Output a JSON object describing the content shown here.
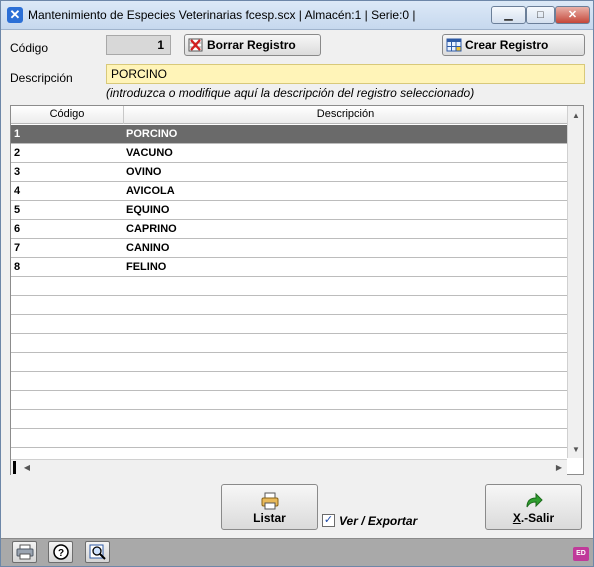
{
  "window": {
    "title": "Mantenimiento de Especies Veterinarias fcesp.scx   | Almacén:1 | Serie:0 |",
    "icon": "app-x-icon"
  },
  "form": {
    "codigo_label": "Código",
    "codigo_value": "1",
    "borrar_label": "Borrar Registro",
    "crear_label": "Crear Registro",
    "descripcion_label": "Descripción",
    "descripcion_value": "PORCINO",
    "hint": "(introduzca o modifique aquí la descripción del registro seleccionado)"
  },
  "grid": {
    "columns": [
      "Código",
      "Descripción"
    ],
    "rows": [
      {
        "codigo": "1",
        "descripcion": "PORCINO"
      },
      {
        "codigo": "2",
        "descripcion": "VACUNO"
      },
      {
        "codigo": "3",
        "descripcion": "OVINO"
      },
      {
        "codigo": "4",
        "descripcion": "AVICOLA"
      },
      {
        "codigo": "5",
        "descripcion": "EQUINO"
      },
      {
        "codigo": "6",
        "descripcion": "CAPRINO"
      },
      {
        "codigo": "7",
        "descripcion": "CANINO"
      },
      {
        "codigo": "8",
        "descripcion": "FELINO"
      }
    ],
    "selected_row": 0
  },
  "actions": {
    "listar_label": "Listar",
    "ver_exportar_label": "Ver / Exportar",
    "ver_exportar_checked": true,
    "salir_label": "X.-Salir"
  },
  "statusbar": {
    "icons": [
      "printer-icon",
      "help-icon",
      "preview-search-icon"
    ],
    "badge_icon": "ed-badge-icon"
  },
  "colors": {
    "description_bg": "#fff4b8",
    "selected_row_bg": "#6a6a6a",
    "statusbar_bg": "#a9a9a9"
  }
}
